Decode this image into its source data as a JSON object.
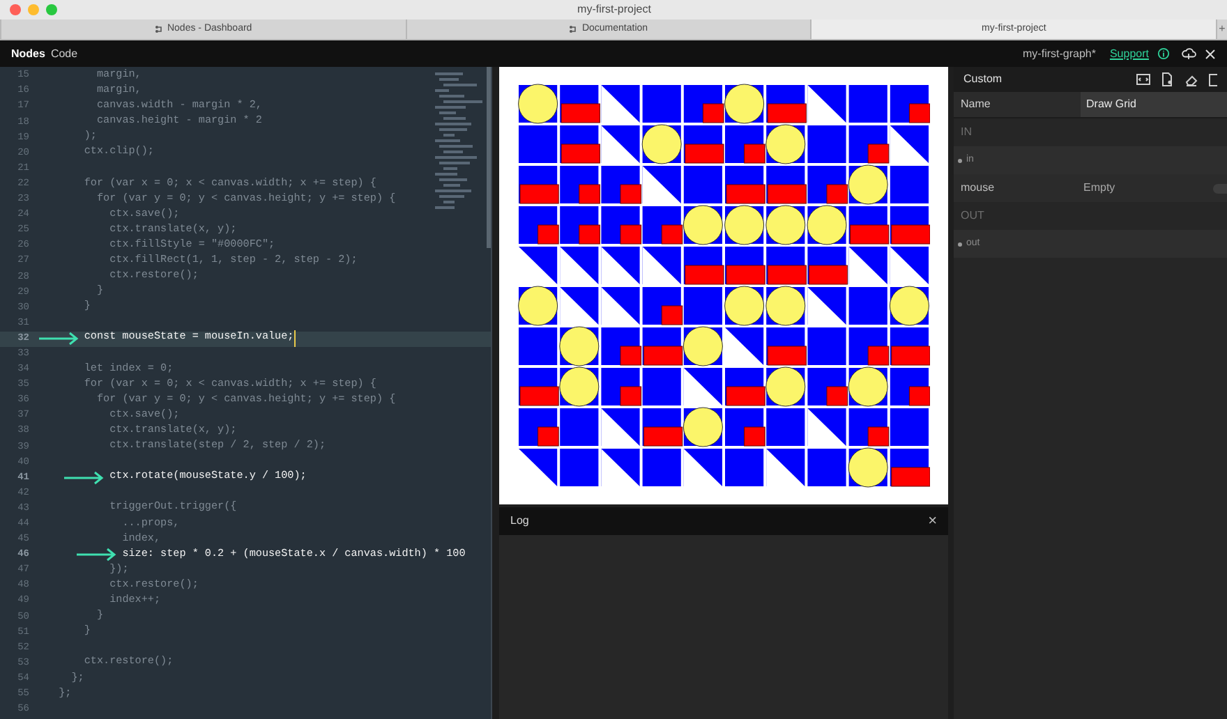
{
  "window": {
    "title": "my-first-project"
  },
  "browser_tabs": [
    {
      "label": "Nodes - Dashboard",
      "icon": true,
      "selected": false
    },
    {
      "label": "Documentation",
      "icon": true,
      "selected": false
    },
    {
      "label": "my-first-project",
      "icon": false,
      "selected": true
    }
  ],
  "new_tab": "+",
  "app_bar": {
    "modes": [
      {
        "label": "Nodes",
        "selected": true
      },
      {
        "label": "Code",
        "selected": false
      }
    ],
    "graph_name": "my-first-graph*",
    "support_link": "Support"
  },
  "code": {
    "lines": [
      {
        "number": "15",
        "text": "        margin,",
        "kind": "dim",
        "arrow": false,
        "highlight": false
      },
      {
        "number": "16",
        "text": "        margin,",
        "kind": "dim",
        "arrow": false,
        "highlight": false
      },
      {
        "number": "17",
        "text": "        canvas.width - margin * 2,",
        "kind": "dim",
        "arrow": false,
        "highlight": false
      },
      {
        "number": "18",
        "text": "        canvas.height - margin * 2",
        "kind": "dim",
        "arrow": false,
        "highlight": false
      },
      {
        "number": "19",
        "text": "      );",
        "kind": "dim",
        "arrow": false,
        "highlight": false
      },
      {
        "number": "20",
        "text": "      ctx.clip();",
        "kind": "dim",
        "arrow": false,
        "highlight": false
      },
      {
        "number": "21",
        "kind": "dim",
        "arrow": false,
        "highlight": false
      },
      {
        "number": "22",
        "text": "      for (var x = 0; x < canvas.width; x += step) {",
        "kind": "dim",
        "arrow": false,
        "highlight": false
      },
      {
        "number": "23",
        "text": "        for (var y = 0; y < canvas.height; y += step) {",
        "kind": "dim",
        "arrow": false,
        "highlight": false
      },
      {
        "number": "24",
        "text": "          ctx.save();",
        "kind": "dim",
        "arrow": false,
        "highlight": false
      },
      {
        "number": "25",
        "text": "          ctx.translate(x, y);",
        "kind": "dim",
        "arrow": false,
        "highlight": false
      },
      {
        "number": "26",
        "text": "          ctx.fillStyle = \"#0000FC\";",
        "kind": "dim",
        "arrow": false,
        "highlight": false
      },
      {
        "number": "27",
        "text": "          ctx.fillRect(1, 1, step - 2, step - 2);",
        "kind": "dim",
        "arrow": false,
        "highlight": false
      },
      {
        "number": "28",
        "text": "          ctx.restore();",
        "kind": "dim",
        "arrow": false,
        "highlight": false
      },
      {
        "number": "29",
        "text": "        }",
        "kind": "dim",
        "arrow": false,
        "highlight": false
      },
      {
        "number": "30",
        "text": "      }",
        "kind": "dim",
        "arrow": false,
        "highlight": false
      },
      {
        "number": "31",
        "kind": "dim",
        "arrow": false,
        "highlight": false
      },
      {
        "number": "32",
        "text": "      const mouseState = mouseIn.value;",
        "kind": "bright",
        "arrow": true,
        "highlight": true
      },
      {
        "number": "33",
        "kind": "dim",
        "arrow": false,
        "highlight": false
      },
      {
        "number": "34",
        "text": "      let index = 0;",
        "kind": "dim",
        "arrow": false,
        "highlight": false
      },
      {
        "number": "35",
        "text": "      for (var x = 0; x < canvas.width; x += step) {",
        "kind": "dim",
        "arrow": false,
        "highlight": false
      },
      {
        "number": "36",
        "text": "        for (var y = 0; y < canvas.height; y += step) {",
        "kind": "dim",
        "arrow": false,
        "highlight": false
      },
      {
        "number": "37",
        "text": "          ctx.save();",
        "kind": "dim",
        "arrow": false,
        "highlight": false
      },
      {
        "number": "38",
        "text": "          ctx.translate(x, y);",
        "kind": "dim",
        "arrow": false,
        "highlight": false
      },
      {
        "number": "39",
        "text": "          ctx.translate(step / 2, step / 2);",
        "kind": "dim",
        "arrow": false,
        "highlight": false
      },
      {
        "number": "40",
        "kind": "dim",
        "arrow": false,
        "highlight": false
      },
      {
        "number": "41",
        "text": "          ctx.rotate(mouseState.y / 100);",
        "kind": "bright",
        "arrow": true,
        "highlight": false
      },
      {
        "number": "42",
        "kind": "dim",
        "arrow": false,
        "highlight": false
      },
      {
        "number": "43",
        "text": "          triggerOut.trigger({",
        "kind": "dim",
        "arrow": false,
        "highlight": false
      },
      {
        "number": "44",
        "text": "            ...props,",
        "kind": "dim",
        "arrow": false,
        "highlight": false
      },
      {
        "number": "45",
        "text": "            index,",
        "kind": "dim",
        "arrow": false,
        "highlight": false
      },
      {
        "number": "46",
        "text": "            size: step * 0.2 + (mouseState.x / canvas.width) * 100",
        "kind": "bright",
        "arrow": true,
        "highlight": false
      },
      {
        "number": "47",
        "text": "          });",
        "kind": "dim",
        "arrow": false,
        "highlight": false
      },
      {
        "number": "48",
        "text": "          ctx.restore();",
        "kind": "dim",
        "arrow": false,
        "highlight": false
      },
      {
        "number": "49",
        "text": "          index++;",
        "kind": "dim",
        "arrow": false,
        "highlight": false
      },
      {
        "number": "50",
        "text": "        }",
        "kind": "dim",
        "arrow": false,
        "highlight": false
      },
      {
        "number": "51",
        "text": "      }",
        "kind": "dim",
        "arrow": false,
        "highlight": false
      },
      {
        "number": "52",
        "kind": "dim",
        "arrow": false,
        "highlight": false
      },
      {
        "number": "53",
        "text": "      ctx.restore();",
        "kind": "dim",
        "arrow": false,
        "highlight": false
      },
      {
        "number": "54",
        "text": "    };",
        "kind": "dim",
        "arrow": false,
        "highlight": false
      },
      {
        "number": "55",
        "text": "  };",
        "kind": "dim",
        "arrow": false,
        "highlight": false
      },
      {
        "number": "56",
        "kind": "dim",
        "arrow": false,
        "highlight": false
      }
    ]
  },
  "log": {
    "title": "Log",
    "close": "×"
  },
  "inspector": {
    "title": "Custom",
    "rows": [
      {
        "kind": "field",
        "label": "Name",
        "value": "Draw Grid"
      },
      {
        "kind": "section",
        "label": "IN"
      },
      {
        "kind": "port",
        "label": "in"
      },
      {
        "kind": "param",
        "label": "mouse",
        "value": "Empty",
        "on": false
      },
      {
        "kind": "section",
        "label": "OUT"
      },
      {
        "kind": "port",
        "label": "out"
      }
    ]
  }
}
